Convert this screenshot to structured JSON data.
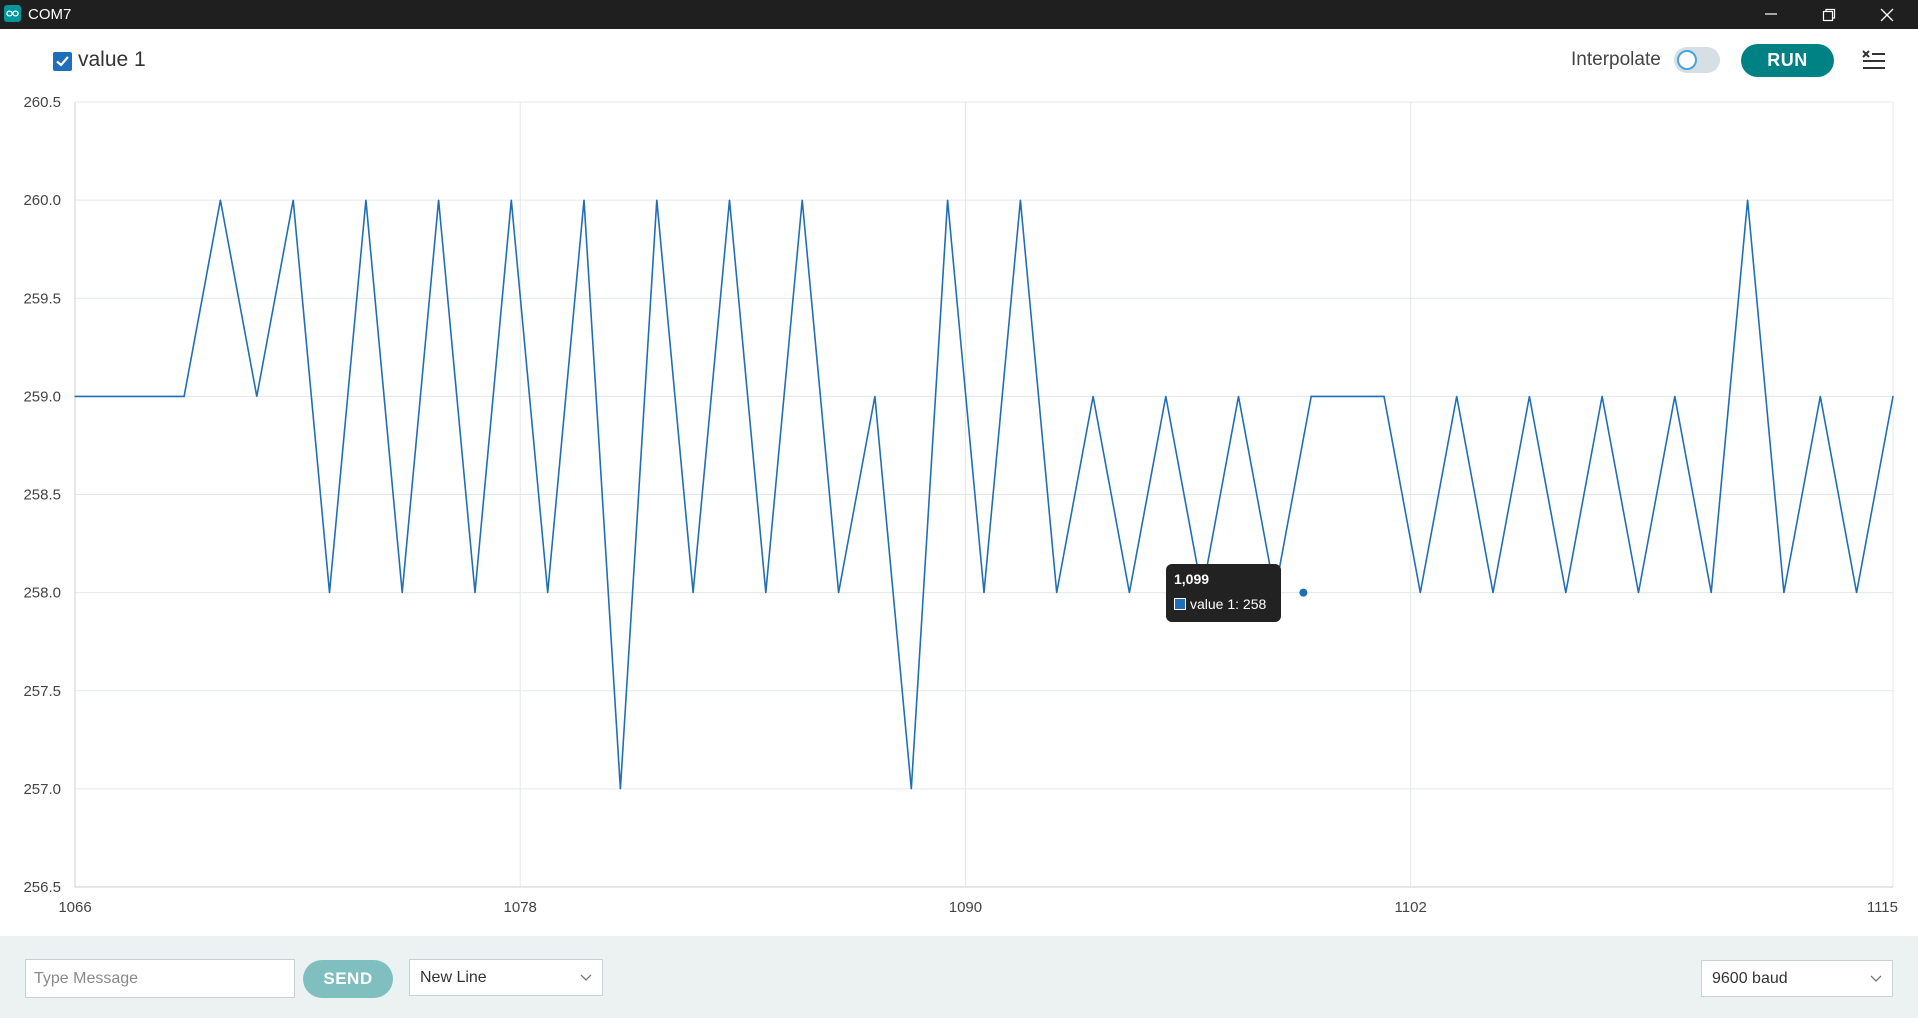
{
  "window": {
    "title": "COM7"
  },
  "toolbar": {
    "legend_label": "value 1",
    "legend_checked": true,
    "interpolate_label": "Interpolate",
    "interpolate_on": false,
    "run_label": "RUN"
  },
  "tooltip": {
    "x_label": "1,099",
    "series_text": "value 1: 258"
  },
  "footer": {
    "message_placeholder": "Type Message",
    "message_value": "",
    "send_label": "SEND",
    "line_ending": "New Line",
    "baud": "9600 baud"
  },
  "colors": {
    "series": "#1f6fb8",
    "accent": "#008184",
    "send_disabled": "#7fbfc0",
    "footer_bg": "#ecf1f1",
    "titlebar": "#1f1f1f"
  },
  "chart_data": {
    "type": "line",
    "title": "",
    "xlabel": "",
    "ylabel": "",
    "x": [
      1066,
      1067,
      1068,
      1069,
      1070,
      1071,
      1072,
      1073,
      1074,
      1075,
      1076,
      1077,
      1078,
      1079,
      1080,
      1081,
      1082,
      1083,
      1084,
      1085,
      1086,
      1087,
      1088,
      1089,
      1090,
      1091,
      1092,
      1093,
      1094,
      1095,
      1096,
      1097,
      1098,
      1099,
      1100,
      1101,
      1102,
      1103,
      1104,
      1105,
      1106,
      1107,
      1108,
      1109,
      1110,
      1111,
      1112,
      1113,
      1114,
      1115
    ],
    "series": [
      {
        "name": "value 1",
        "values": [
          259,
          259,
          259,
          259,
          260,
          259,
          260,
          258,
          260,
          258,
          260,
          258,
          260,
          258,
          260,
          257,
          260,
          258,
          260,
          258,
          260,
          258,
          259,
          257,
          260,
          258,
          260,
          258,
          259,
          258,
          259,
          258,
          259,
          258,
          259,
          259,
          259,
          258,
          259,
          258,
          259,
          258,
          259,
          258,
          259,
          258,
          260,
          258,
          259,
          258,
          259
        ]
      }
    ],
    "xlim": [
      1066,
      1115
    ],
    "ylim": [
      256.5,
      260.5
    ],
    "x_ticks": [
      "1066",
      "1078",
      "1090",
      "1102",
      "1115"
    ],
    "y_ticks": [
      "256.5",
      "257.0",
      "257.5",
      "258.0",
      "258.5",
      "259.0",
      "259.5",
      "260.0",
      "260.5"
    ],
    "grid": true,
    "legend": "top-left",
    "highlight": {
      "x": 1099,
      "y": 258
    }
  }
}
